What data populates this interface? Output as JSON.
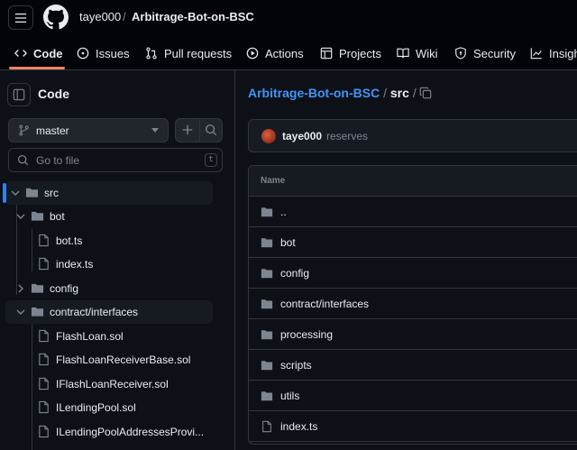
{
  "header": {
    "owner": "taye000",
    "separator": "/",
    "repo": "Arbitrage-Bot-on-BSC"
  },
  "tabs": [
    {
      "label": "Code",
      "icon": "code-icon",
      "active": true
    },
    {
      "label": "Issues",
      "icon": "issue-opened-icon"
    },
    {
      "label": "Pull requests",
      "icon": "git-pull-request-icon"
    },
    {
      "label": "Actions",
      "icon": "play-icon"
    },
    {
      "label": "Projects",
      "icon": "table-icon"
    },
    {
      "label": "Wiki",
      "icon": "book-icon"
    },
    {
      "label": "Security",
      "icon": "shield-icon"
    },
    {
      "label": "Insights",
      "icon": "graph-icon"
    }
  ],
  "sidebar": {
    "title": "Code",
    "branch": "master",
    "go_to_file": "Go to file",
    "go_to_file_key": "t",
    "tree": [
      {
        "label": "src",
        "type": "dir",
        "expanded": true,
        "selected": true
      },
      {
        "label": "bot",
        "type": "dir",
        "expanded": true
      },
      {
        "label": "bot.ts",
        "type": "file"
      },
      {
        "label": "index.ts",
        "type": "file"
      },
      {
        "label": "config",
        "type": "dir",
        "expanded": false
      },
      {
        "label": "contract/interfaces",
        "type": "dir",
        "expanded": true,
        "highlighted": true
      },
      {
        "label": "FlashLoan.sol",
        "type": "file"
      },
      {
        "label": "FlashLoanReceiverBase.sol",
        "type": "file"
      },
      {
        "label": "IFlashLoanReceiver.sol",
        "type": "file"
      },
      {
        "label": "ILendingPool.sol",
        "type": "file"
      },
      {
        "label": "ILendingPoolAddressesProvi...",
        "type": "file"
      }
    ]
  },
  "main": {
    "breadcrumb_repo": "Arbitrage-Bot-on-BSC",
    "breadcrumb_sep": "/",
    "breadcrumb_dir": "src",
    "breadcrumb_trail": "/",
    "commit_user": "taye000",
    "commit_message": "reserves",
    "table_header": "Name",
    "rows": [
      {
        "label": "..",
        "type": "dir"
      },
      {
        "label": "bot",
        "type": "dir"
      },
      {
        "label": "config",
        "type": "dir"
      },
      {
        "label": "contract/interfaces",
        "type": "dir"
      },
      {
        "label": "processing",
        "type": "dir"
      },
      {
        "label": "scripts",
        "type": "dir"
      },
      {
        "label": "utils",
        "type": "dir"
      },
      {
        "label": "index.ts",
        "type": "file"
      }
    ]
  },
  "colors": {
    "accent": "#4493f8",
    "tab_underline": "#f78166",
    "background": "#0d1117"
  }
}
